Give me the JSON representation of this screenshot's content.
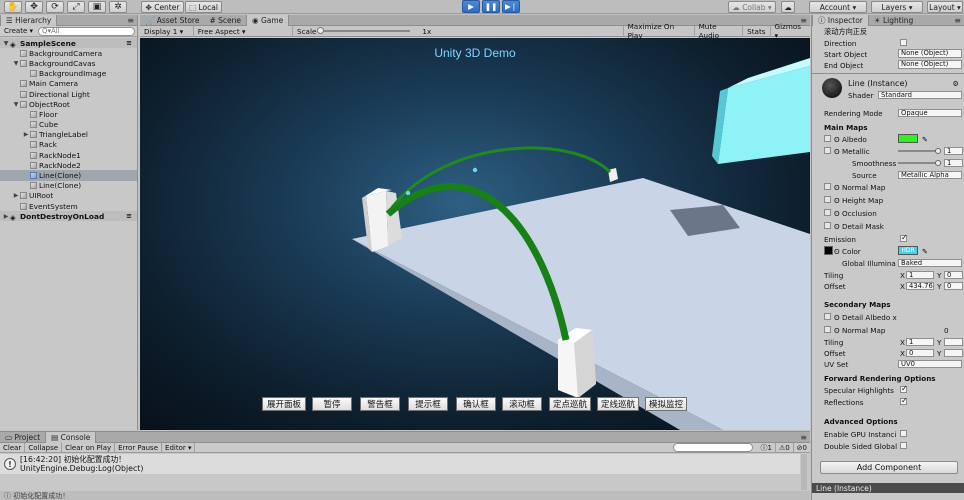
{
  "toolbar": {
    "tools": [
      "✋",
      "✥",
      "⟳",
      "⤢",
      "▣",
      "✲"
    ],
    "center_label": "Center",
    "local_label": "Local",
    "collab_label": "Collab ▾",
    "account_label": "Account",
    "layers_label": "Layers",
    "layout_label": "Layout",
    "play": "▶",
    "pause": "❚❚",
    "step": "▶❘"
  },
  "hierarchy": {
    "tab_label": "Hierarchy",
    "create_label": "Create ▾",
    "search_placeholder": "Q▾All",
    "rows": [
      {
        "label": "SampleScene",
        "depth": 0,
        "arrow": "▼",
        "scene": true
      },
      {
        "label": "BackgroundCamera",
        "depth": 1,
        "arrow": ""
      },
      {
        "label": "BackgroundCavas",
        "depth": 1,
        "arrow": "▼"
      },
      {
        "label": "BackgroundImage",
        "depth": 2,
        "arrow": ""
      },
      {
        "label": "Main Camera",
        "depth": 1,
        "arrow": ""
      },
      {
        "label": "Directional Light",
        "depth": 1,
        "arrow": ""
      },
      {
        "label": "ObjectRoot",
        "depth": 1,
        "arrow": "▼"
      },
      {
        "label": "Floor",
        "depth": 2,
        "arrow": ""
      },
      {
        "label": "Cube",
        "depth": 2,
        "arrow": ""
      },
      {
        "label": "TriangleLabel",
        "depth": 2,
        "arrow": "▶"
      },
      {
        "label": "Rack",
        "depth": 2,
        "arrow": ""
      },
      {
        "label": "RackNode1",
        "depth": 2,
        "arrow": ""
      },
      {
        "label": "RackNode2",
        "depth": 2,
        "arrow": ""
      },
      {
        "label": "Line(Clone)",
        "depth": 2,
        "arrow": "",
        "selected": true
      },
      {
        "label": "Line(Clone)",
        "depth": 2,
        "arrow": ""
      },
      {
        "label": "UIRoot",
        "depth": 1,
        "arrow": "▶"
      },
      {
        "label": "EventSystem",
        "depth": 1,
        "arrow": ""
      },
      {
        "label": "DontDestroyOnLoad",
        "depth": 0,
        "arrow": "▶",
        "scene": true
      }
    ]
  },
  "center_tabs": {
    "asset_store": "Asset Store",
    "scene": "Scene",
    "game": "Game"
  },
  "game_toolbar": {
    "display": "Display 1 ▾",
    "aspect": "Free Aspect ▾",
    "scale_label": "Scale",
    "scale_value": "1x",
    "maximize": "Maximize On Play",
    "mute": "Mute Audio",
    "stats": "Stats",
    "gizmos": "Gizmos ▾"
  },
  "game": {
    "title": "Unity 3D Demo",
    "buttons": [
      "展开面板",
      "暂停",
      "警告框",
      "提示框",
      "确认框",
      "滚动框",
      "定点巡航",
      "定线巡航",
      "模拟监控"
    ]
  },
  "console": {
    "project_tab": "Project",
    "console_tab": "Console",
    "clear": "Clear",
    "collapse": "Collapse",
    "clear_on_play": "Clear on Play",
    "error_pause": "Error Pause",
    "editor": "Editor ▾",
    "search_placeholder": "",
    "counts": [
      "1",
      "0",
      "0"
    ],
    "entry_line1": "[16:42:20] 初始化配置成功！",
    "entry_line2": "UnityEngine.Debug:Log(Object)",
    "status": "初始化配置成功！"
  },
  "inspector": {
    "tab_inspector": "Inspector",
    "tab_lighting": "Lighting",
    "subtitle": "滚动方向正反",
    "direction_label": "Direction",
    "start_object_label": "Start Object",
    "start_object_value": "None (Object)",
    "end_object_label": "End Object",
    "end_object_value": "None (Object)",
    "material_name": "Line (Instance)",
    "shader_label": "Shader",
    "shader_value": "Standard",
    "rendering_mode_label": "Rendering Mode",
    "rendering_mode_value": "Opaque",
    "main_maps": "Main Maps",
    "albedo": "Albedo",
    "albedo_color": "#33ee22",
    "metallic": "Metallic",
    "metallic_value": "1",
    "smoothness": "Smoothness",
    "smoothness_value": "1",
    "source": "Source",
    "source_value": "Metallic Alpha",
    "normal_map": "Normal Map",
    "height_map": "Height Map",
    "occlusion": "Occlusion",
    "detail_mask": "Detail Mask",
    "emission": "Emission",
    "color": "Color",
    "hdr": "HDR",
    "emission_color": "#4bd0ea",
    "global_illum": "Global Illumina",
    "global_illum_value": "Baked",
    "tiling": "Tiling",
    "offset": "Offset",
    "x_label": "X",
    "y_label": "Y",
    "tiling_x": "1",
    "tiling_y": "0",
    "offset_x": "434.76",
    "offset_y": "0",
    "secondary_maps": "Secondary Maps",
    "detail_albedo": "Detail Albedo x",
    "normal_map2": "Normal Map",
    "normal_map2_value": "0",
    "tiling2_x": "1",
    "tiling2_y": "",
    "offset2_x": "0",
    "offset2_y": "",
    "uv_set": "UV Set",
    "uv_set_value": "UV0",
    "forward_options": "Forward Rendering Options",
    "specular": "Specular Highlights",
    "reflections": "Reflections",
    "advanced_options": "Advanced Options",
    "gpu_instancing": "Enable GPU Instanci",
    "double_sided": "Double Sided Global",
    "add_component": "Add Component",
    "footer": "Line (Instance)"
  }
}
